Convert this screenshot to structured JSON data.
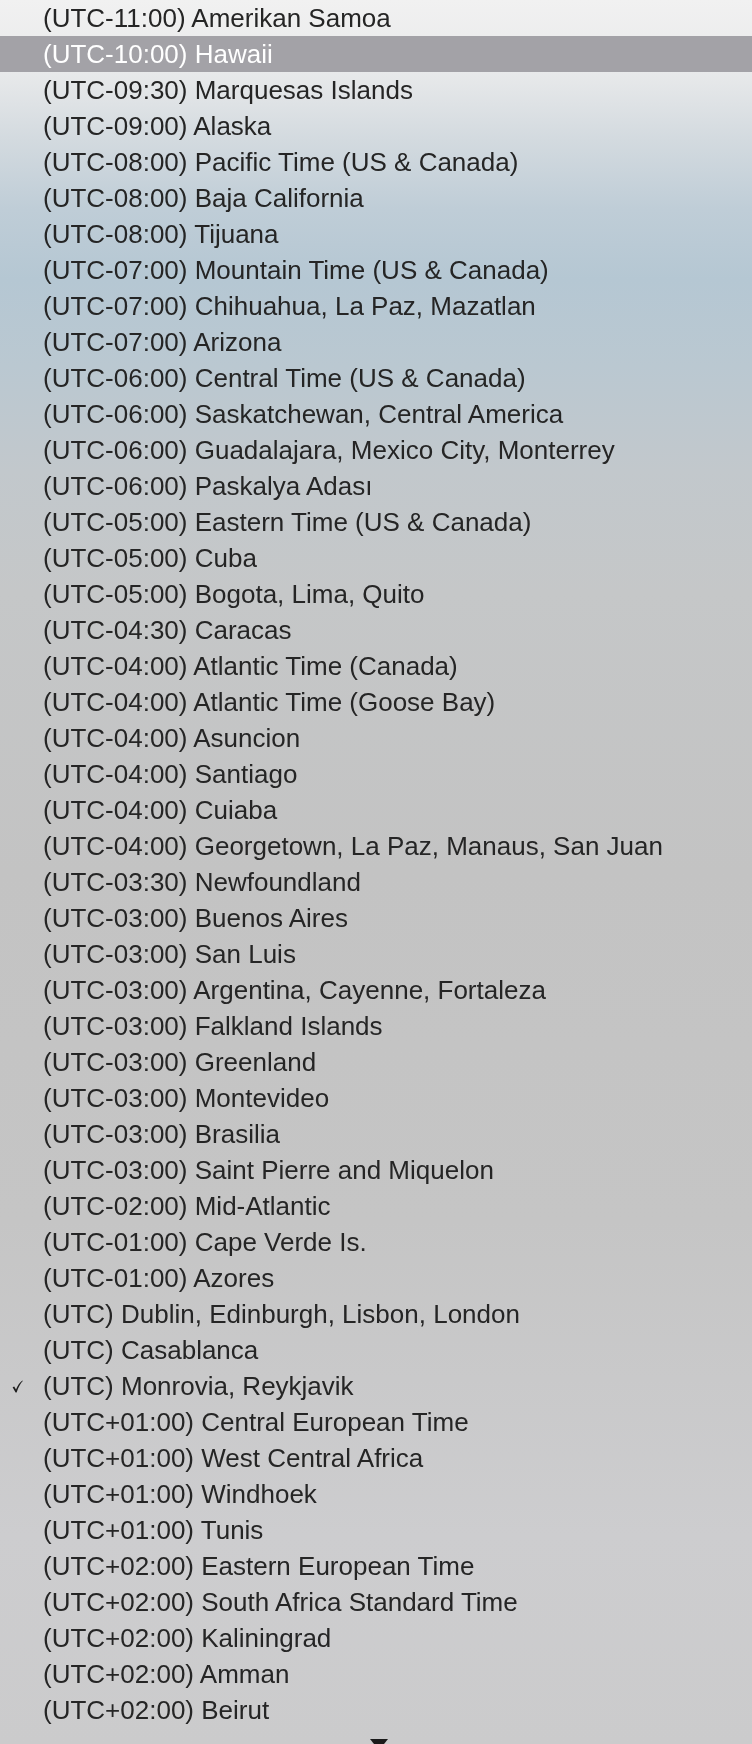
{
  "menu": {
    "items": [
      {
        "label": "(UTC-11:00) Amerikan Samoa",
        "selected": false,
        "checked": false
      },
      {
        "label": "(UTC-10:00) Hawaii",
        "selected": true,
        "checked": false
      },
      {
        "label": "(UTC-09:30) Marquesas Islands",
        "selected": false,
        "checked": false
      },
      {
        "label": "(UTC-09:00) Alaska",
        "selected": false,
        "checked": false
      },
      {
        "label": "(UTC-08:00) Pacific Time (US & Canada)",
        "selected": false,
        "checked": false
      },
      {
        "label": "(UTC-08:00) Baja California",
        "selected": false,
        "checked": false
      },
      {
        "label": "(UTC-08:00) Tijuana",
        "selected": false,
        "checked": false
      },
      {
        "label": "(UTC-07:00) Mountain Time (US & Canada)",
        "selected": false,
        "checked": false
      },
      {
        "label": "(UTC-07:00) Chihuahua, La Paz, Mazatlan",
        "selected": false,
        "checked": false
      },
      {
        "label": "(UTC-07:00) Arizona",
        "selected": false,
        "checked": false
      },
      {
        "label": "(UTC-06:00) Central Time (US & Canada)",
        "selected": false,
        "checked": false
      },
      {
        "label": "(UTC-06:00) Saskatchewan, Central America",
        "selected": false,
        "checked": false
      },
      {
        "label": "(UTC-06:00) Guadalajara, Mexico City, Monterrey",
        "selected": false,
        "checked": false
      },
      {
        "label": "(UTC-06:00) Paskalya Adası",
        "selected": false,
        "checked": false
      },
      {
        "label": "(UTC-05:00) Eastern Time (US & Canada)",
        "selected": false,
        "checked": false
      },
      {
        "label": "(UTC-05:00) Cuba",
        "selected": false,
        "checked": false
      },
      {
        "label": "(UTC-05:00) Bogota, Lima, Quito",
        "selected": false,
        "checked": false
      },
      {
        "label": "(UTC-04:30) Caracas",
        "selected": false,
        "checked": false
      },
      {
        "label": "(UTC-04:00) Atlantic Time (Canada)",
        "selected": false,
        "checked": false
      },
      {
        "label": "(UTC-04:00) Atlantic Time (Goose Bay)",
        "selected": false,
        "checked": false
      },
      {
        "label": "(UTC-04:00) Asuncion",
        "selected": false,
        "checked": false
      },
      {
        "label": "(UTC-04:00) Santiago",
        "selected": false,
        "checked": false
      },
      {
        "label": "(UTC-04:00) Cuiaba",
        "selected": false,
        "checked": false
      },
      {
        "label": "(UTC-04:00) Georgetown, La Paz, Manaus, San Juan",
        "selected": false,
        "checked": false
      },
      {
        "label": "(UTC-03:30) Newfoundland",
        "selected": false,
        "checked": false
      },
      {
        "label": "(UTC-03:00) Buenos Aires",
        "selected": false,
        "checked": false
      },
      {
        "label": "(UTC-03:00) San Luis",
        "selected": false,
        "checked": false
      },
      {
        "label": "(UTC-03:00) Argentina, Cayenne, Fortaleza",
        "selected": false,
        "checked": false
      },
      {
        "label": "(UTC-03:00) Falkland Islands",
        "selected": false,
        "checked": false
      },
      {
        "label": "(UTC-03:00) Greenland",
        "selected": false,
        "checked": false
      },
      {
        "label": "(UTC-03:00) Montevideo",
        "selected": false,
        "checked": false
      },
      {
        "label": "(UTC-03:00) Brasilia",
        "selected": false,
        "checked": false
      },
      {
        "label": "(UTC-03:00) Saint Pierre and Miquelon",
        "selected": false,
        "checked": false
      },
      {
        "label": "(UTC-02:00) Mid-Atlantic",
        "selected": false,
        "checked": false
      },
      {
        "label": "(UTC-01:00) Cape Verde Is.",
        "selected": false,
        "checked": false
      },
      {
        "label": "(UTC-01:00) Azores",
        "selected": false,
        "checked": false
      },
      {
        "label": "(UTC) Dublin, Edinburgh, Lisbon, London",
        "selected": false,
        "checked": false
      },
      {
        "label": "(UTC) Casablanca",
        "selected": false,
        "checked": false
      },
      {
        "label": "(UTC) Monrovia, Reykjavik",
        "selected": false,
        "checked": true
      },
      {
        "label": "(UTC+01:00) Central European Time",
        "selected": false,
        "checked": false
      },
      {
        "label": "(UTC+01:00) West Central Africa",
        "selected": false,
        "checked": false
      },
      {
        "label": "(UTC+01:00) Windhoek",
        "selected": false,
        "checked": false
      },
      {
        "label": "(UTC+01:00) Tunis",
        "selected": false,
        "checked": false
      },
      {
        "label": "(UTC+02:00) Eastern European Time",
        "selected": false,
        "checked": false
      },
      {
        "label": "(UTC+02:00) South Africa Standard Time",
        "selected": false,
        "checked": false
      },
      {
        "label": "(UTC+02:00) Kaliningrad",
        "selected": false,
        "checked": false
      },
      {
        "label": "(UTC+02:00) Amman",
        "selected": false,
        "checked": false
      },
      {
        "label": "(UTC+02:00) Beirut",
        "selected": false,
        "checked": false
      }
    ]
  }
}
